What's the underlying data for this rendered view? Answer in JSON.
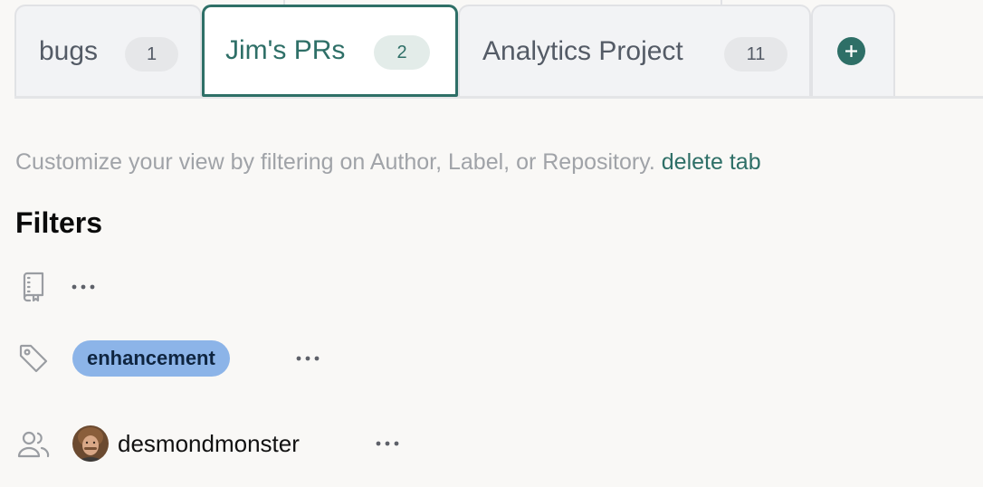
{
  "tabs": [
    {
      "label": "bugs",
      "count": "1",
      "active": false
    },
    {
      "label": "Jim's PRs",
      "count": "2",
      "active": true
    },
    {
      "label": "Analytics Project",
      "count": "11",
      "active": false
    }
  ],
  "add_tab_icon": "plus-circle-icon",
  "description": {
    "text": "Customize your view by filtering on Author, Label, or Repository.",
    "delete_link": "delete tab"
  },
  "filters": {
    "heading": "Filters",
    "repository": {
      "icon": "repository-icon",
      "menu_icon": "ellipsis-icon"
    },
    "label": {
      "icon": "tag-icon",
      "value": "enhancement",
      "chip_color": "#8cb4e8",
      "menu_icon": "ellipsis-icon"
    },
    "author": {
      "icon": "people-icon",
      "username": "desmondmonster",
      "menu_icon": "ellipsis-icon"
    }
  },
  "colors": {
    "accent": "#2e6f67",
    "background": "#f9f8f6",
    "muted_text": "#a0a3a8"
  }
}
